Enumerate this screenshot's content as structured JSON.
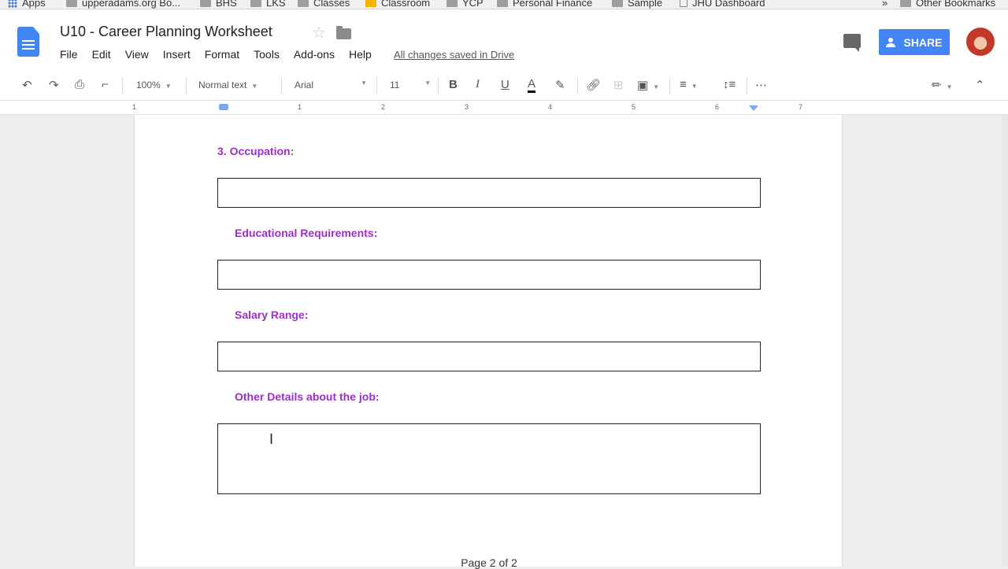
{
  "bookmarks": [
    {
      "label": "Apps",
      "icon": "apps-grid-icon"
    },
    {
      "label": "upperadams.org Bo...",
      "icon": "folder-icon"
    },
    {
      "label": "BHS",
      "icon": "folder-icon"
    },
    {
      "label": "LKS",
      "icon": "folder-icon"
    },
    {
      "label": "Classes",
      "icon": "folder-icon"
    },
    {
      "label": "Classroom",
      "icon": "classroom-icon"
    },
    {
      "label": "YCP",
      "icon": "folder-icon"
    },
    {
      "label": "Personal Finance",
      "icon": "folder-icon"
    },
    {
      "label": "Sample",
      "icon": "folder-icon"
    },
    {
      "label": "JHU Dashboard",
      "icon": "file-icon"
    },
    {
      "label": "»",
      "icon": ""
    },
    {
      "label": "Other Bookmarks",
      "icon": "folder-icon"
    }
  ],
  "header": {
    "title": "U10 - Career Planning Worksheet",
    "menu": [
      "File",
      "Edit",
      "View",
      "Insert",
      "Format",
      "Tools",
      "Add-ons",
      "Help"
    ],
    "saved_status": "All changes saved in Drive",
    "share_label": "SHARE"
  },
  "toolbar": {
    "zoom": "100%",
    "style": "Normal text",
    "font": "Arial",
    "size": "11"
  },
  "ruler": {
    "ticks": [
      "1",
      "1",
      "2",
      "3",
      "4",
      "5",
      "6",
      "7"
    ]
  },
  "document": {
    "q3_label": "3.  Occupation:",
    "edu_label": "Educational Requirements:",
    "salary_label": "Salary Range:",
    "other_label": "Other Details about the job:",
    "page_indicator": "Page 2 of 2"
  },
  "colors": {
    "accent_purple": "#9b2fc7",
    "share_blue": "#4285f4"
  }
}
